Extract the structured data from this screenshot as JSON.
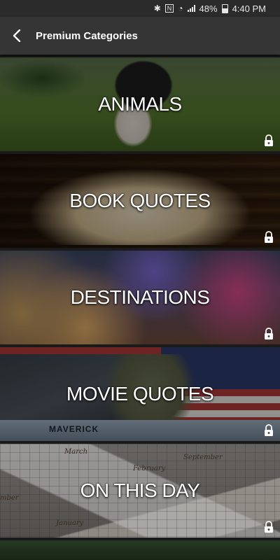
{
  "status_bar": {
    "battery": "48%",
    "time": "4:40 PM",
    "icons": [
      "bluetooth-icon",
      "nfc-icon",
      "wifi-icon",
      "signal-icon",
      "battery-icon"
    ]
  },
  "app_bar": {
    "title": "Premium Categories",
    "back_icon": "back-arrow-icon",
    "background": "#353535"
  },
  "categories": [
    {
      "label": "ANIMALS",
      "locked": true,
      "icon": "lock-icon"
    },
    {
      "label": "BOOK QUOTES",
      "locked": true,
      "icon": "lock-icon"
    },
    {
      "label": "DESTINATIONS",
      "locked": true,
      "icon": "lock-icon"
    },
    {
      "label": "MOVIE QUOTES",
      "locked": true,
      "icon": "lock-icon"
    },
    {
      "label": "ON THIS DAY",
      "locked": true,
      "icon": "lock-icon"
    }
  ],
  "calendar": {
    "months": [
      "March",
      "February",
      "September",
      "January",
      "mber"
    ]
  },
  "movie": {
    "jet_name": "MAVERICK"
  }
}
